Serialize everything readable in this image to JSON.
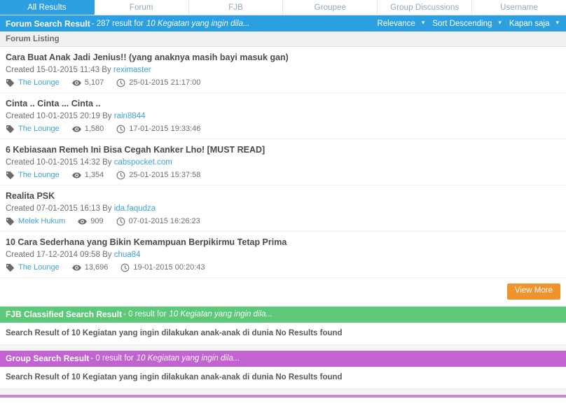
{
  "tabs": [
    {
      "label": "All Results",
      "active": true
    },
    {
      "label": "Forum",
      "active": false
    },
    {
      "label": "FJB",
      "active": false
    },
    {
      "label": "Groupee",
      "active": false
    },
    {
      "label": "Group Discussions",
      "active": false
    },
    {
      "label": "Username",
      "active": false
    }
  ],
  "forum_section": {
    "title": "Forum Search Result",
    "count_text": "- 287 result for",
    "query": "10 Kegiatan yang ingin dila...",
    "controls": [
      {
        "label": "Relevance",
        "caret": "▾"
      },
      {
        "label": "Sort Descending",
        "caret": "▾"
      },
      {
        "label": "Kapan saja",
        "caret": "▾"
      }
    ],
    "listing_header": "Forum Listing",
    "view_more_label": "View More",
    "results": [
      {
        "title": "Cara Buat Anak Jadi Jenius!! (yang anaknya masih bayi masuk gan)",
        "created_label": "Created 15-01-2015 11:43 By",
        "author": "reximaster",
        "forum": "The Lounge",
        "views": "5,107",
        "last_post": "25-01-2015 21:17:00"
      },
      {
        "title": "Cinta .. Cinta ... Cinta ..",
        "created_label": "Created 10-01-2015 20:19 By",
        "author": "rain8844",
        "forum": "The Lounge",
        "views": "1,580",
        "last_post": "17-01-2015 19:33:46"
      },
      {
        "title": "6 Kebiasaan Remeh Ini Bisa Cegah Kanker Lho! [MUST READ]",
        "created_label": "Created 10-01-2015 14:32 By",
        "author": "cabspocket.com",
        "forum": "The Lounge",
        "views": "1,354",
        "last_post": "25-01-2015 15:37:58"
      },
      {
        "title": "Realita PSK",
        "created_label": "Created 07-01-2015 16:13 By",
        "author": "ida.faqudza",
        "forum": "Melek Hukum",
        "views": "909",
        "last_post": "07-01-2015 16:26:23"
      },
      {
        "title": "10 Cara Sederhana yang Bikin Kemampuan Berpikirmu Tetap Prima",
        "created_label": "Created 17-12-2014 09:58 By",
        "author": "chua84",
        "forum": "The Lounge",
        "views": "13,696",
        "last_post": "19-01-2015 00:20:43"
      }
    ]
  },
  "fjb_section": {
    "title": "FJB Classified Search Result",
    "count_text": "- 0 result for",
    "query": "10 Kegiatan yang ingin dila...",
    "no_result": "Search Result of 10 Kegiatan yang ingin dilakukan anak-anak di dunia No Results found"
  },
  "group_section": {
    "title": "Group Search Result",
    "count_text": "- 0 result for",
    "query": "10 Kegiatan yang ingin dila...",
    "no_result": "Search Result of 10 Kegiatan yang ingin dilakukan anak-anak di dunia No Results found"
  },
  "colors": {
    "forum_accent": "#2c9fe0",
    "fjb_accent": "#5cc878",
    "group_accent": "#c164d2",
    "button_accent": "#f0932d",
    "link": "#3ba3dd"
  }
}
